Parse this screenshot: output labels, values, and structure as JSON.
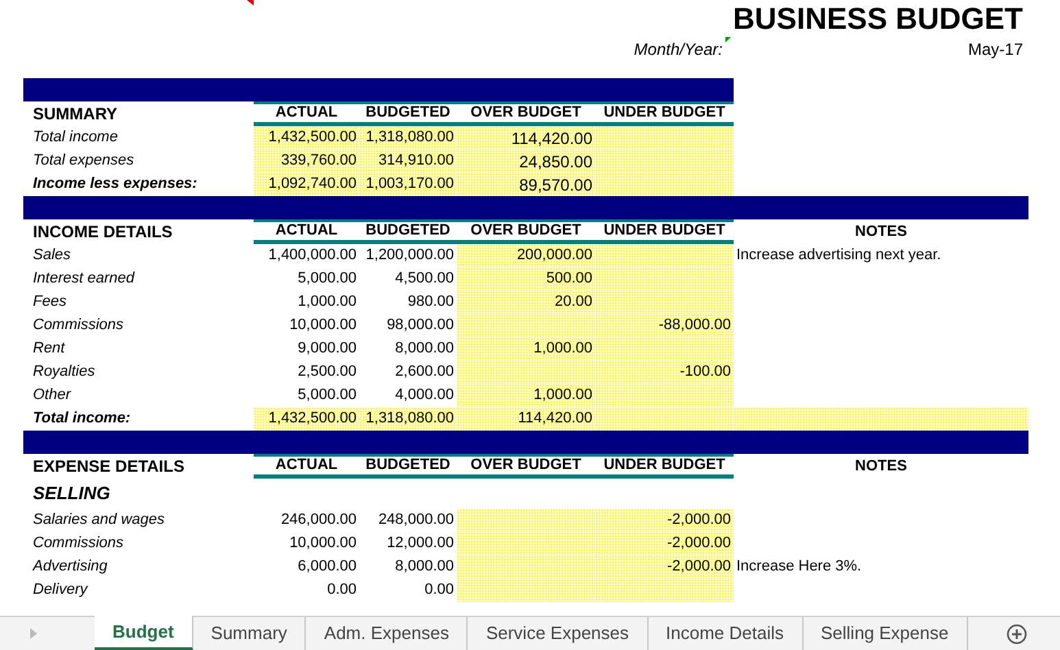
{
  "title": "BUSINESS BUDGET",
  "month_year": {
    "label": "Month/Year:",
    "value": "May-17"
  },
  "sections": [
    {
      "kind": "summary",
      "heading": "SUMMARY",
      "columns": [
        "ACTUAL",
        "BUDGETED",
        "OVER BUDGET",
        "UNDER BUDGET"
      ],
      "rows": [
        {
          "kind": "item",
          "label": "Total income",
          "actual": "1,432,500.00",
          "budgeted": "1,318,080.00",
          "over": "114,420.00",
          "under": ""
        },
        {
          "kind": "item",
          "label": "Total expenses",
          "actual": "339,760.00",
          "budgeted": "314,910.00",
          "over": "24,850.00",
          "under": ""
        },
        {
          "kind": "total",
          "label": "Income less expenses:",
          "actual": "1,092,740.00",
          "budgeted": "1,003,170.00",
          "over": "89,570.00",
          "under": ""
        }
      ]
    },
    {
      "kind": "details",
      "heading": "INCOME DETAILS",
      "columns": [
        "ACTUAL",
        "BUDGETED",
        "OVER BUDGET",
        "UNDER BUDGET"
      ],
      "notes_heading": "NOTES",
      "rows": [
        {
          "kind": "item",
          "label": "Sales",
          "actual": "1,400,000.00",
          "budgeted": "1,200,000.00",
          "over": "200,000.00",
          "under": "",
          "note": "Increase advertising next year."
        },
        {
          "kind": "item",
          "label": "Interest earned",
          "actual": "5,000.00",
          "budgeted": "4,500.00",
          "over": "500.00",
          "under": ""
        },
        {
          "kind": "item",
          "label": "Fees",
          "actual": "1,000.00",
          "budgeted": "980.00",
          "over": "20.00",
          "under": ""
        },
        {
          "kind": "item",
          "label": "Commissions",
          "actual": "10,000.00",
          "budgeted": "98,000.00",
          "over": "",
          "under": "-88,000.00"
        },
        {
          "kind": "item",
          "label": "Rent",
          "actual": "9,000.00",
          "budgeted": "8,000.00",
          "over": "1,000.00",
          "under": ""
        },
        {
          "kind": "item",
          "label": "Royalties",
          "actual": "2,500.00",
          "budgeted": "2,600.00",
          "over": "",
          "under": "-100.00"
        },
        {
          "kind": "item",
          "label": "Other",
          "actual": "5,000.00",
          "budgeted": "4,000.00",
          "over": "1,000.00",
          "under": ""
        },
        {
          "kind": "total",
          "label": "Total income:",
          "actual": "1,432,500.00",
          "budgeted": "1,318,080.00",
          "over": "114,420.00",
          "under": ""
        }
      ]
    },
    {
      "kind": "details",
      "heading": "EXPENSE DETAILS",
      "columns": [
        "ACTUAL",
        "BUDGETED",
        "OVER BUDGET",
        "UNDER BUDGET"
      ],
      "notes_heading": "NOTES",
      "subheading": "SELLING",
      "rows": [
        {
          "kind": "item",
          "label": "Salaries and wages",
          "actual": "246,000.00",
          "budgeted": "248,000.00",
          "over": "",
          "under": "-2,000.00"
        },
        {
          "kind": "item",
          "label": "Commissions",
          "actual": "10,000.00",
          "budgeted": "12,000.00",
          "over": "",
          "under": "-2,000.00"
        },
        {
          "kind": "item",
          "label": "Advertising",
          "actual": "6,000.00",
          "budgeted": "8,000.00",
          "over": "",
          "under": "-2,000.00",
          "note": "Increase Here 3%."
        },
        {
          "kind": "item",
          "label": "Delivery",
          "actual": "0.00",
          "budgeted": "0.00",
          "over": "",
          "under": ""
        }
      ]
    }
  ],
  "sheet_tabs": [
    {
      "label": "Budget",
      "selected": true
    },
    {
      "label": "Summary",
      "selected": false
    },
    {
      "label": "Adm. Expenses",
      "selected": false
    },
    {
      "label": "Service Expenses",
      "selected": false
    },
    {
      "label": "Income Details",
      "selected": false
    },
    {
      "label": "Selling Expense",
      "selected": false
    }
  ]
}
